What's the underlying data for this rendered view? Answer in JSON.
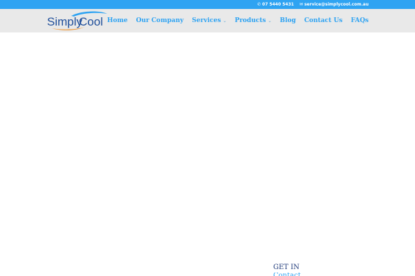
{
  "topbar": {
    "phone": "07 5440 5431",
    "email": "service@simplycool.com.au",
    "phone_icon": "phone-icon",
    "email_icon": "envelope-icon"
  },
  "logo": {
    "text_simply": "Simply",
    "text_cool": "Cool",
    "colors": {
      "simply": "#1f4e9a",
      "cool": "#1f4e9a",
      "swoosh_blue": "#2ea3f2",
      "swoosh_orange": "#f08a1c"
    }
  },
  "nav": {
    "home": "Home",
    "our_company": "Our Company",
    "services": "Services",
    "products": "Products",
    "blog": "Blog",
    "contact_us": "Contact Us",
    "faqs": "FAQs",
    "chevron": "⌄"
  },
  "footer_partial": {
    "get_in": "GET IN",
    "next_line": "Contact"
  },
  "colors": {
    "accent": "#2ea3f2",
    "header_bg": "#e9e9e9",
    "heading_dark": "#1f3a7a"
  }
}
